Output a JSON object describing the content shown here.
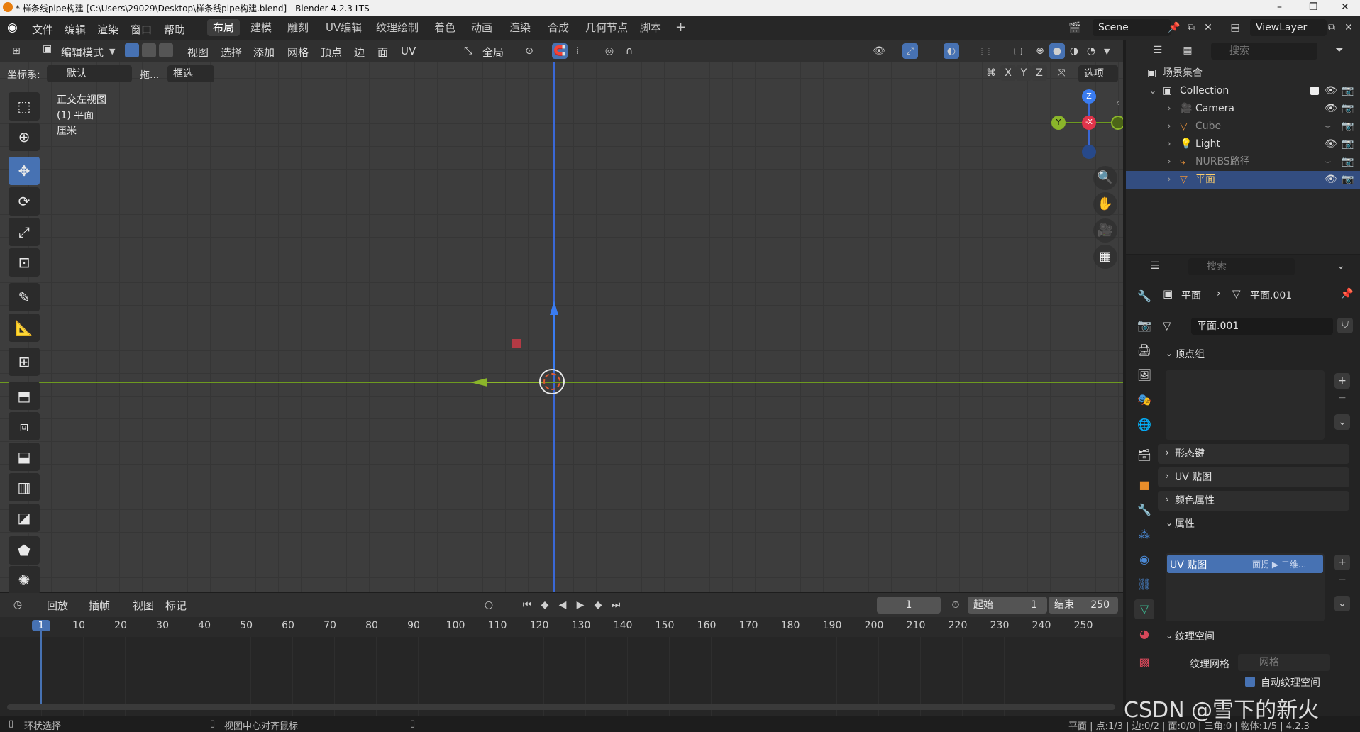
{
  "window": {
    "title": "* 样条线pipe构建 [C:\\Users\\29029\\Desktop\\样条线pipe构建.blend] - Blender 4.2.3 LTS",
    "controls": [
      "–",
      "❐",
      "✕"
    ]
  },
  "menu": [
    "文件",
    "编辑",
    "渲染",
    "窗口",
    "帮助"
  ],
  "workspaces": [
    "布局",
    "建模",
    "雕刻",
    "UV编辑",
    "纹理绘制",
    "着色",
    "动画",
    "渲染",
    "合成",
    "几何节点",
    "脚本"
  ],
  "active_workspace": "布局",
  "add_workspace": "+",
  "scene": {
    "label": "Scene"
  },
  "viewlayer": {
    "label": "ViewLayer"
  },
  "viewport_header": {
    "mode": "编辑模式",
    "menus": [
      "视图",
      "选择",
      "添加",
      "网格",
      "顶点",
      "边",
      "面",
      "UV"
    ],
    "transform_orientation": "全局",
    "coord_label": "坐标系:",
    "coord_value": "默认",
    "drag_label": "拖...",
    "select_mode": "框选",
    "axes": [
      "X",
      "Y",
      "Z"
    ],
    "options": "选项"
  },
  "viewport_overlay": {
    "view_name": "正交左视图",
    "object": "(1) 平面",
    "units": "厘米"
  },
  "gizmo": {
    "z": "Z",
    "y": "Y",
    "x": "-X"
  },
  "outliner": {
    "search_placeholder": "搜索",
    "root": "场景集合",
    "collection": "Collection",
    "items": [
      {
        "name": "Camera",
        "dim": false,
        "selected": false
      },
      {
        "name": "Cube",
        "dim": true,
        "selected": false
      },
      {
        "name": "Light",
        "dim": false,
        "selected": false
      },
      {
        "name": "NURBS路径",
        "dim": true,
        "selected": false
      },
      {
        "name": "平面",
        "dim": false,
        "selected": true
      }
    ]
  },
  "properties": {
    "search_placeholder": "搜索",
    "breadcrumb_object": "平面",
    "breadcrumb_data": "平面.001",
    "mesh_name": "平面.001",
    "panels": {
      "vertex_groups": "顶点组",
      "shape_keys": "形态键",
      "uv_maps": "UV 贴图",
      "color_attributes": "颜色属性",
      "attributes": "属性",
      "texture_space": "纹理空间"
    },
    "attribute_item": {
      "name": "UV 贴图",
      "domain": "面拐 ▶ 二维..."
    },
    "texture_mesh_label": "纹理网格",
    "texture_mesh_placeholder": "网格",
    "auto_texture_space": "自动纹理空间"
  },
  "timeline": {
    "menus": [
      "回放",
      "插帧",
      "视图",
      "标记"
    ],
    "current_frame": "1",
    "start_label": "起始",
    "start_value": "1",
    "end_label": "结束",
    "end_value": "250",
    "ruler": [
      "1",
      "10",
      "20",
      "30",
      "40",
      "50",
      "60",
      "70",
      "80",
      "90",
      "100",
      "110",
      "120",
      "130",
      "140",
      "150",
      "160",
      "170",
      "180",
      "190",
      "200",
      "210",
      "220",
      "230",
      "240",
      "250"
    ]
  },
  "statusbar": {
    "left": "环状选择",
    "middle": "视图中心对齐鼠标",
    "right": "平面 | 点:1/3 | 边:0/2 | 面:0/0 | 三角:0 | 物体:1/5 | 4.2.3"
  },
  "watermark": "CSDN @雪下的新火"
}
